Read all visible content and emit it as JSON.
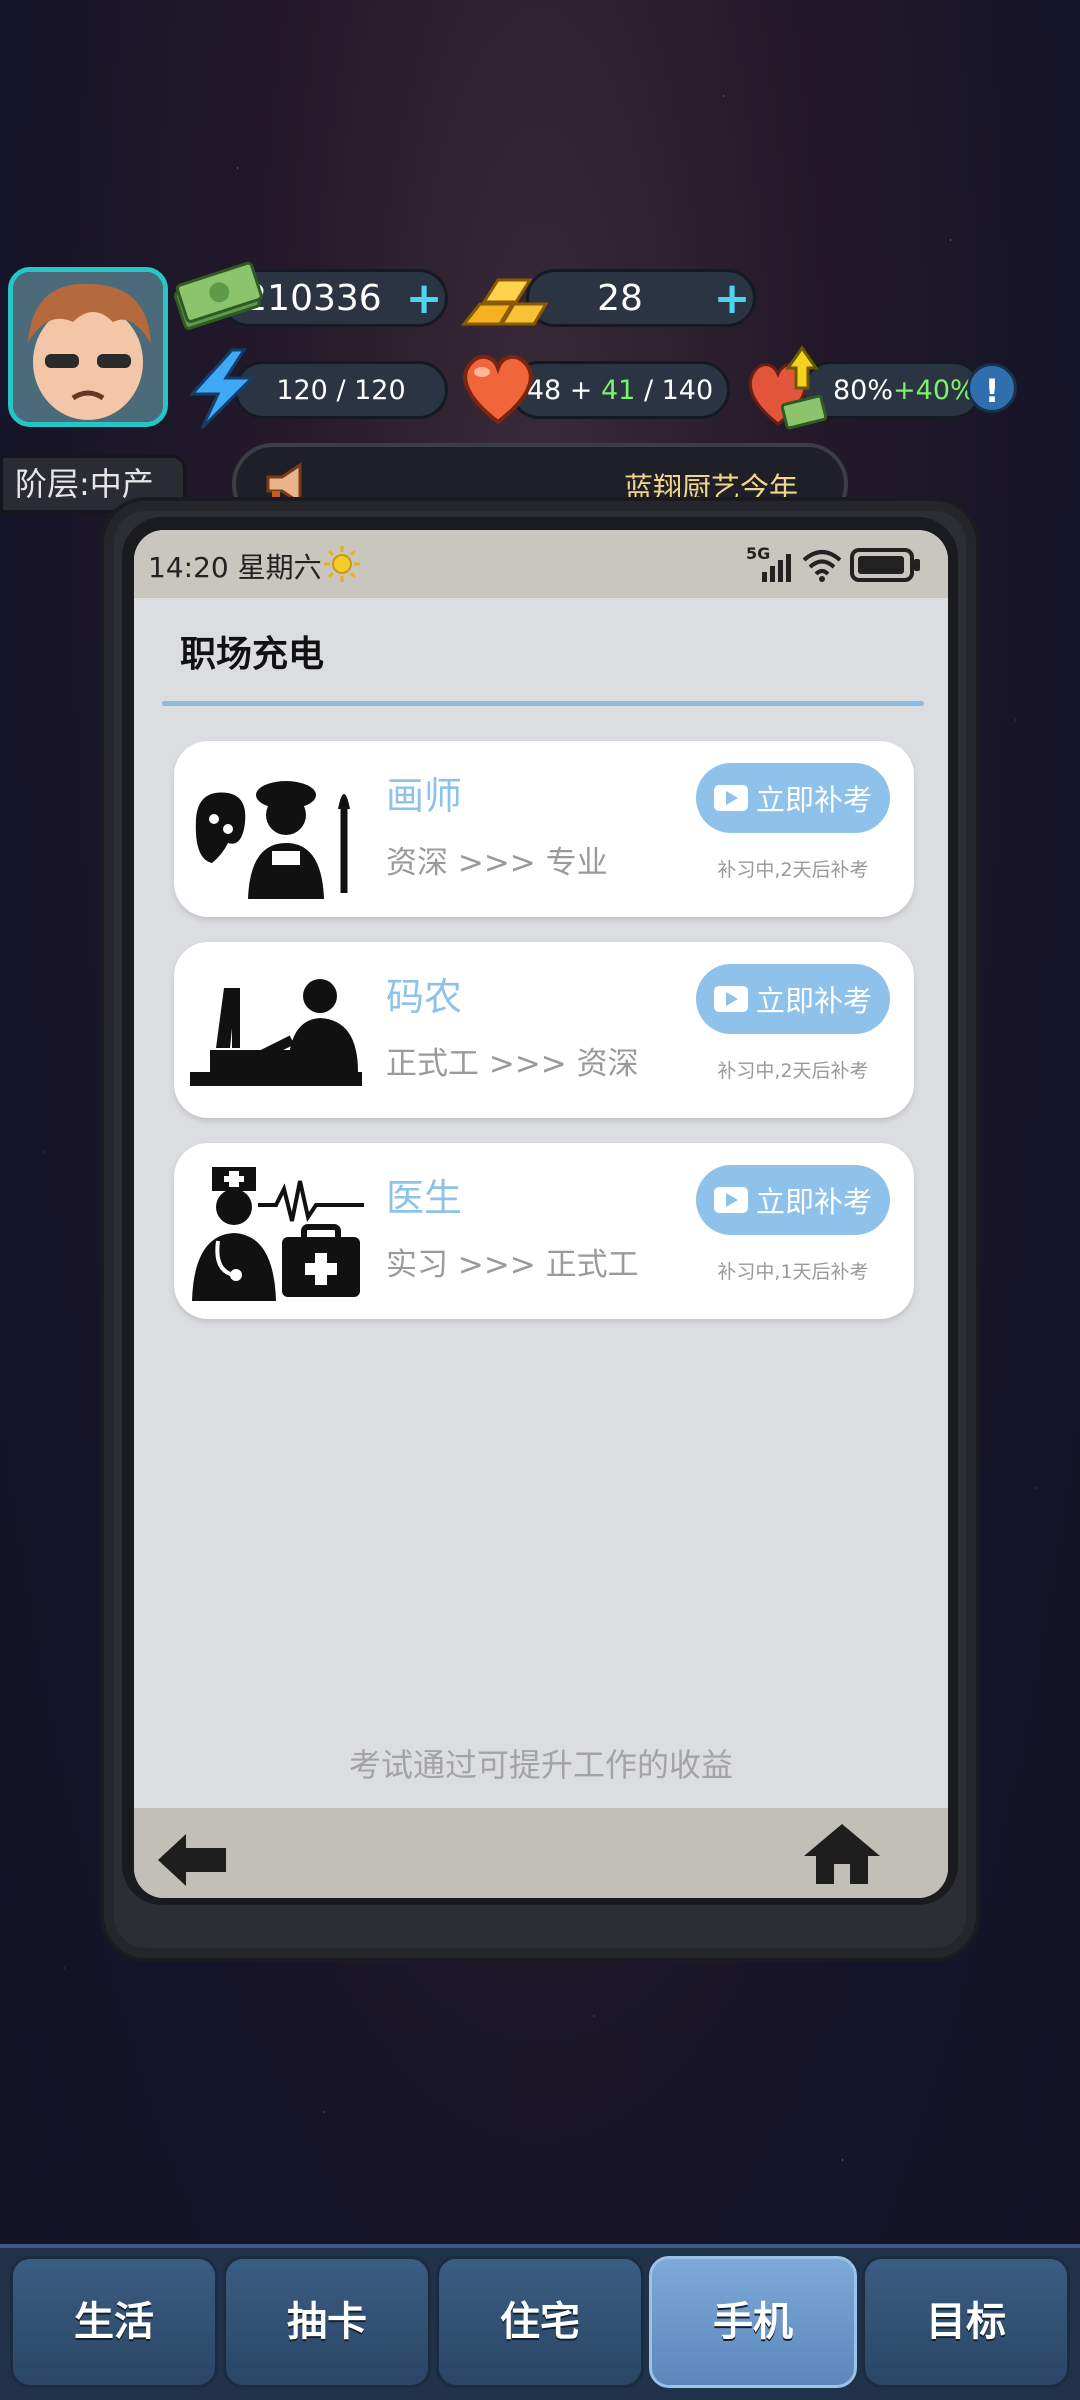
{
  "hud": {
    "money": "210336",
    "gold": "28",
    "energy": "120 / 120",
    "health_base": "48 +",
    "health_bonus": "41",
    "health_max": "/ 140",
    "mood_value": "80%",
    "mood_bonus": "+40%",
    "plus_symbol": "+",
    "alert_symbol": "!",
    "layer_label": "阶层:中产",
    "marquee_text": "蓝翔厨艺今年"
  },
  "phone": {
    "time": "14:20",
    "weekday": "星期六",
    "network": "5G",
    "title": "职场充电",
    "hint": "考试通过可提升工作的收益",
    "jobs": [
      {
        "name": "画师",
        "progress": "资深 >>> 专业",
        "button": "立即补考",
        "note": "补习中,2天后补考"
      },
      {
        "name": "码农",
        "progress": "正式工 >>> 资深",
        "button": "立即补考",
        "note": "补习中,2天后补考"
      },
      {
        "name": "医生",
        "progress": "实习 >>> 正式工",
        "button": "立即补考",
        "note": "补习中,1天后补考"
      }
    ]
  },
  "tabs": [
    "生活",
    "抽卡",
    "住宅",
    "手机",
    "目标"
  ],
  "colors": {
    "accent": "#8ec2ea",
    "active_tab": "#6f9bcf",
    "plus": "#4fd4f0"
  }
}
